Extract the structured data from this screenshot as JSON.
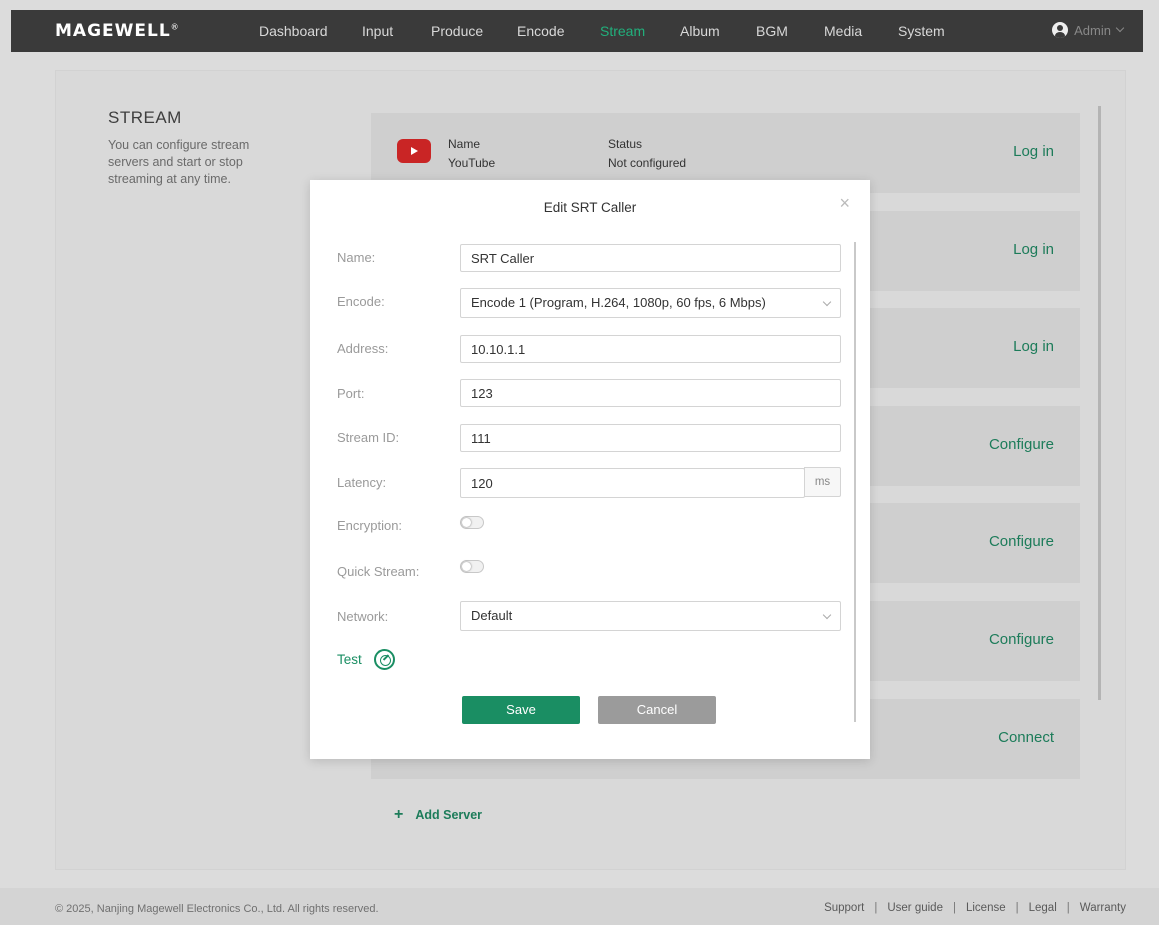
{
  "app": {
    "brand": "MAGEWELL",
    "brand_mark": "®"
  },
  "nav": {
    "items": [
      {
        "label": "Dashboard"
      },
      {
        "label": "Input"
      },
      {
        "label": "Produce"
      },
      {
        "label": "Encode"
      },
      {
        "label": "Stream",
        "active": true
      },
      {
        "label": "Album"
      },
      {
        "label": "BGM"
      },
      {
        "label": "Media"
      },
      {
        "label": "System"
      }
    ],
    "user": "Admin"
  },
  "section": {
    "title": "STREAM",
    "description": "You can configure stream servers and start or stop streaming at any time."
  },
  "servers": [
    {
      "name_header": "Name",
      "name": "YouTube",
      "status_header": "Status",
      "status": "Not configured",
      "action": "Log in",
      "icon": "youtube-icon"
    },
    {
      "action": "Log in"
    },
    {
      "action": "Log in"
    },
    {
      "action": "Configure"
    },
    {
      "action": "Configure"
    },
    {
      "action": "Configure"
    },
    {
      "action": "Connect"
    }
  ],
  "add_server_label": "Add Server",
  "modal": {
    "title": "Edit SRT Caller",
    "close": "×",
    "fields": {
      "name": {
        "label": "Name:",
        "value": "SRT Caller"
      },
      "encode": {
        "label": "Encode:",
        "value": "Encode 1 (Program, H.264, 1080p, 60 fps, 6 Mbps)"
      },
      "address": {
        "label": "Address:",
        "value": "10.10.1.1"
      },
      "port": {
        "label": "Port:",
        "value": "123"
      },
      "stream_id": {
        "label": "Stream ID:",
        "value": "111"
      },
      "latency": {
        "label": "Latency:",
        "value": "120",
        "unit": "ms"
      },
      "encryption": {
        "label": "Encryption:",
        "on": false
      },
      "quick_stream": {
        "label": "Quick Stream:",
        "on": false
      },
      "network": {
        "label": "Network:",
        "value": "Default"
      }
    },
    "test_label": "Test",
    "save_label": "Save",
    "cancel_label": "Cancel"
  },
  "footer": {
    "copyright": "© 2025, Nanjing Magewell Electronics Co., Ltd. All rights reserved.",
    "links": [
      "Support",
      "User guide",
      "License",
      "Legal",
      "Warranty"
    ],
    "separator": "|"
  },
  "colors": {
    "accent": "#1a8e63",
    "nav_bg": "#3a3a3a",
    "youtube_red": "#c92525"
  }
}
